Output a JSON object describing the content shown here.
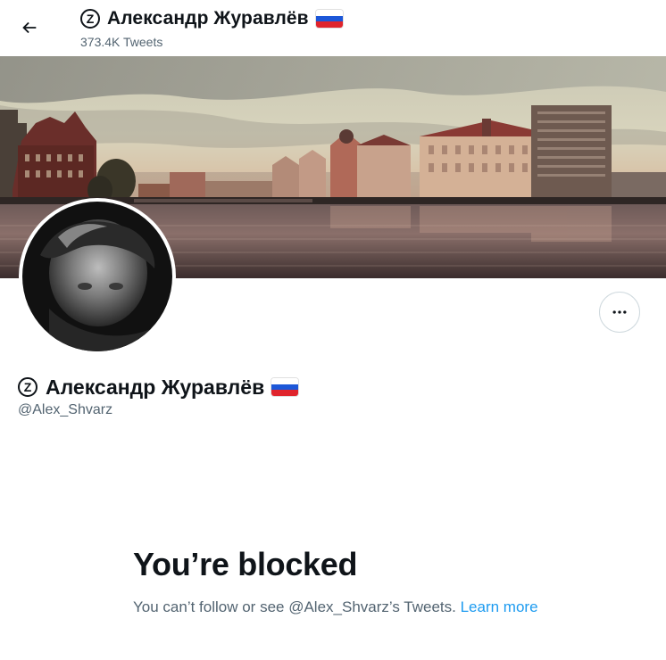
{
  "header": {
    "display_name": "Александр Журавлёв",
    "badge_letter": "Z",
    "tweet_count": "373.4K Tweets",
    "back_icon": "arrow-left-icon"
  },
  "profile": {
    "display_name": "Александр Журавлёв",
    "badge_letter": "Z",
    "handle": "@Alex_Shvarz",
    "flag_icon": "russian-flag-icon",
    "more_icon": "more-horizontal-icon"
  },
  "blocked": {
    "title": "You’re blocked",
    "description": "You can’t follow or see @Alex_Shvarz’s Tweets.",
    "learn_more": "Learn more"
  },
  "colors": {
    "text_primary": "#0f1419",
    "text_secondary": "#536471",
    "link": "#1d9bf0",
    "border": "#cfd9de"
  }
}
